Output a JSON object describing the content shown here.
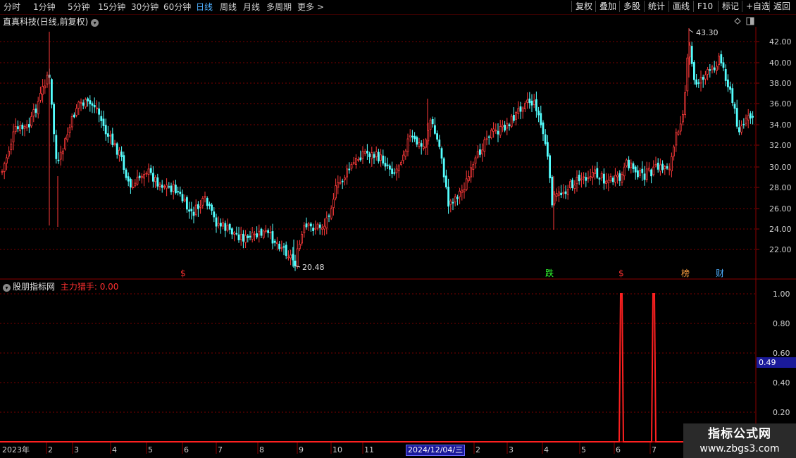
{
  "toolbar": {
    "periods": [
      "分时",
      "1分钟",
      "5分钟",
      "15分钟",
      "30分钟",
      "60分钟",
      "日线",
      "周线",
      "月线",
      "多周期",
      "更多 >"
    ],
    "active_period": "日线",
    "actions": [
      "复权",
      "叠加",
      "多股",
      "统计",
      "画线",
      "F10",
      "标记",
      "+自选",
      "返回"
    ]
  },
  "main_chart": {
    "title": "直真科技(日线,前复权)",
    "max_label": "43.30",
    "min_label": "20.48",
    "y_ticks": [
      "42.00",
      "40.00",
      "38.00",
      "36.00",
      "34.00",
      "32.00",
      "30.00",
      "28.00",
      "26.00",
      "24.00",
      "22.00"
    ],
    "markers": [
      {
        "text": "$",
        "color": "#ff3030"
      },
      {
        "text": "跌",
        "color": "#30ff30"
      },
      {
        "text": "$",
        "color": "#ff3030"
      },
      {
        "text": "榜",
        "color": "#ffa040"
      },
      {
        "text": "财",
        "color": "#4fb0ff"
      }
    ]
  },
  "indicator": {
    "name": "股朋指标网",
    "line_label": "主力猎手: 0.00",
    "y_ticks": [
      "1.00",
      "0.80",
      "0.60",
      "0.40",
      "0.20"
    ],
    "current_value": "0.49"
  },
  "x_axis": {
    "labels": [
      "2023年",
      "2",
      "3",
      "4",
      "5",
      "6",
      "7",
      "8",
      "9",
      "10",
      "11",
      "2",
      "3",
      "4",
      "5",
      "6",
      "7"
    ],
    "cursor_date": "2024/12/04/三"
  },
  "watermark": {
    "line1": "指标公式网",
    "line2": "www.zbgs3.com"
  },
  "colors": {
    "up": "#ff3a3a",
    "down": "#54ffff",
    "grid": "#7a0000",
    "signal": "#ff2020",
    "cursor_bg": "#1a1a9a"
  },
  "chart_data": {
    "type": "bar",
    "title": "主力猎手",
    "x": [
      "2023年",
      "2",
      "3",
      "4",
      "5",
      "6",
      "7",
      "8",
      "9",
      "10",
      "11",
      "12/04",
      "2",
      "3",
      "4",
      "5",
      "6",
      "7"
    ],
    "series": [
      {
        "name": "主力猎手",
        "values": [
          0,
          0,
          0,
          0,
          0,
          0,
          0,
          0,
          0,
          0,
          0,
          0,
          0,
          0,
          0,
          0,
          1.0,
          1.0,
          0
        ]
      }
    ],
    "ylim": [
      0,
      1.1
    ]
  }
}
